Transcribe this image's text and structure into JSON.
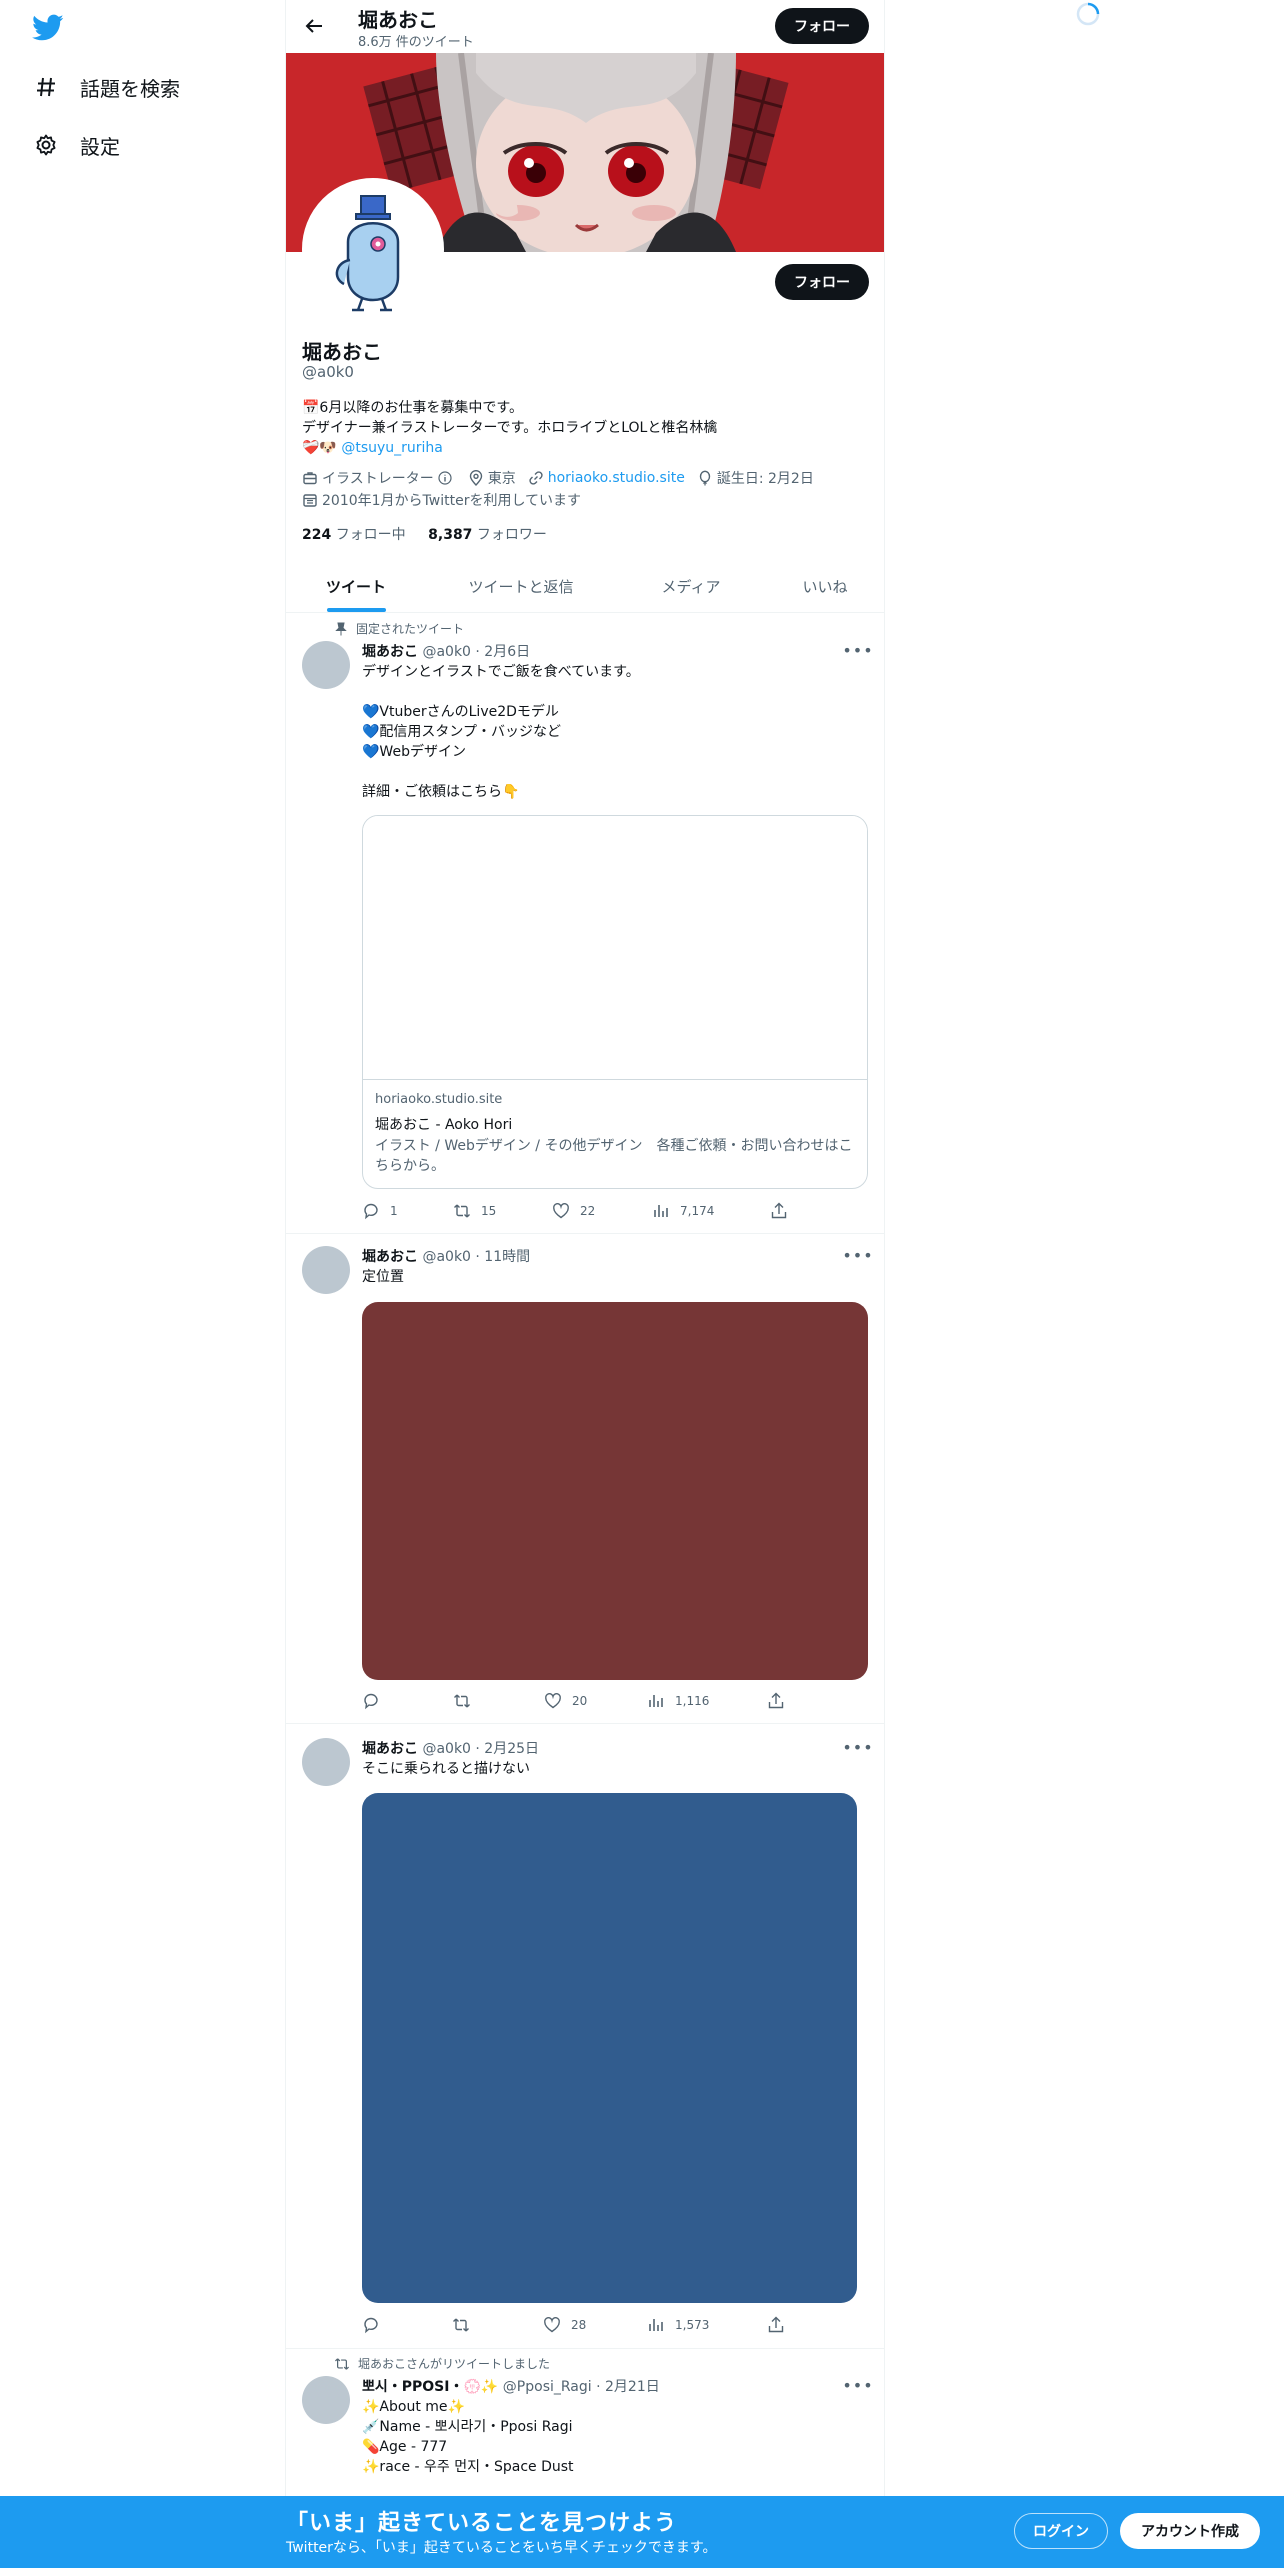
{
  "nav": {
    "items": [
      {
        "label": "話題を検索",
        "icon": "hashtag-icon"
      },
      {
        "label": "設定",
        "icon": "gear-icon"
      }
    ]
  },
  "header": {
    "name": "堀あおこ",
    "tweet_count": "8.6万 件のツイート",
    "follow_label": "フォロー"
  },
  "profile": {
    "name": "堀あおこ",
    "handle": "@a0k0",
    "follow_label": "フォロー",
    "bio_line1": "📅6月以降のお仕事を募集中です。",
    "bio_line2": "デザイナー兼イラストレーターです。ホロライブとLOLと椎名林檎",
    "bio_line3_prefix": "❤️‍🩹🐶 ",
    "bio_link": "@tsuyu_ruriha",
    "job": "イラストレーター",
    "location": "東京",
    "website": "horiaoko.studio.site",
    "birthday": "誕生日: 2月2日",
    "joined": "2010年1月からTwitterを利用しています",
    "following_count": "224",
    "following_label": "フォロー中",
    "followers_count": "8,387",
    "followers_label": "フォロワー"
  },
  "tabs": [
    {
      "label": "ツイート",
      "active": true
    },
    {
      "label": "ツイートと返信",
      "active": false
    },
    {
      "label": "メディア",
      "active": false
    },
    {
      "label": "いいね",
      "active": false
    }
  ],
  "tweets": [
    {
      "context": "固定されたツイート",
      "name": "堀あおこ",
      "meta": "@a0k0 · 2月6日",
      "text": "デザインとイラストでご飯を食べています。\n\n💙VtuberさんのLive2Dモデル\n💙配信用スタンプ・バッジなど\n💙Webデザイン\n\n詳細・ご依頼はこちら👇",
      "card": {
        "domain": "horiaoko.studio.site",
        "title": "堀あおこ - Aoko Hori",
        "description": "イラスト / Webデザイン / その他デザイン　各種ご依頼・お問い合わせはこちらから。"
      },
      "replies": "1",
      "retweets": "15",
      "likes": "22",
      "views": "7,174"
    },
    {
      "name": "堀あおこ",
      "meta": "@a0k0 · 11時間",
      "text": "定位置",
      "media_color": "#763636",
      "replies": "",
      "retweets": "",
      "likes": "20",
      "views": "1,116"
    },
    {
      "name": "堀あおこ",
      "meta": "@a0k0 · 2月25日",
      "text": "そこに乗られると描けない",
      "media_color": "#315c8e",
      "replies": "",
      "retweets": "",
      "likes": "28",
      "views": "1,573"
    },
    {
      "context": "堀あおこさんがリツイートしました",
      "name": "뽀시・PPOSI・💮✨",
      "meta": "@Pposi_Ragi · 2月21日",
      "text": "✨About me✨\n💉Name - 뽀시라기・Pposi Ragi\n💊Age - 777\n✨race - 우주 먼지・Space Dust"
    }
  ],
  "bottom_bar": {
    "title": "「いま」起きていることを見つけよう",
    "subtitle": "Twitterなら、「いま」起きていることをいち早くチェックできます。",
    "login_label": "ログイン",
    "signup_label": "アカウント作成"
  },
  "colors": {
    "accent": "#1d9bf0",
    "banner": "#c8262a",
    "dark_button": "#0f1419"
  }
}
